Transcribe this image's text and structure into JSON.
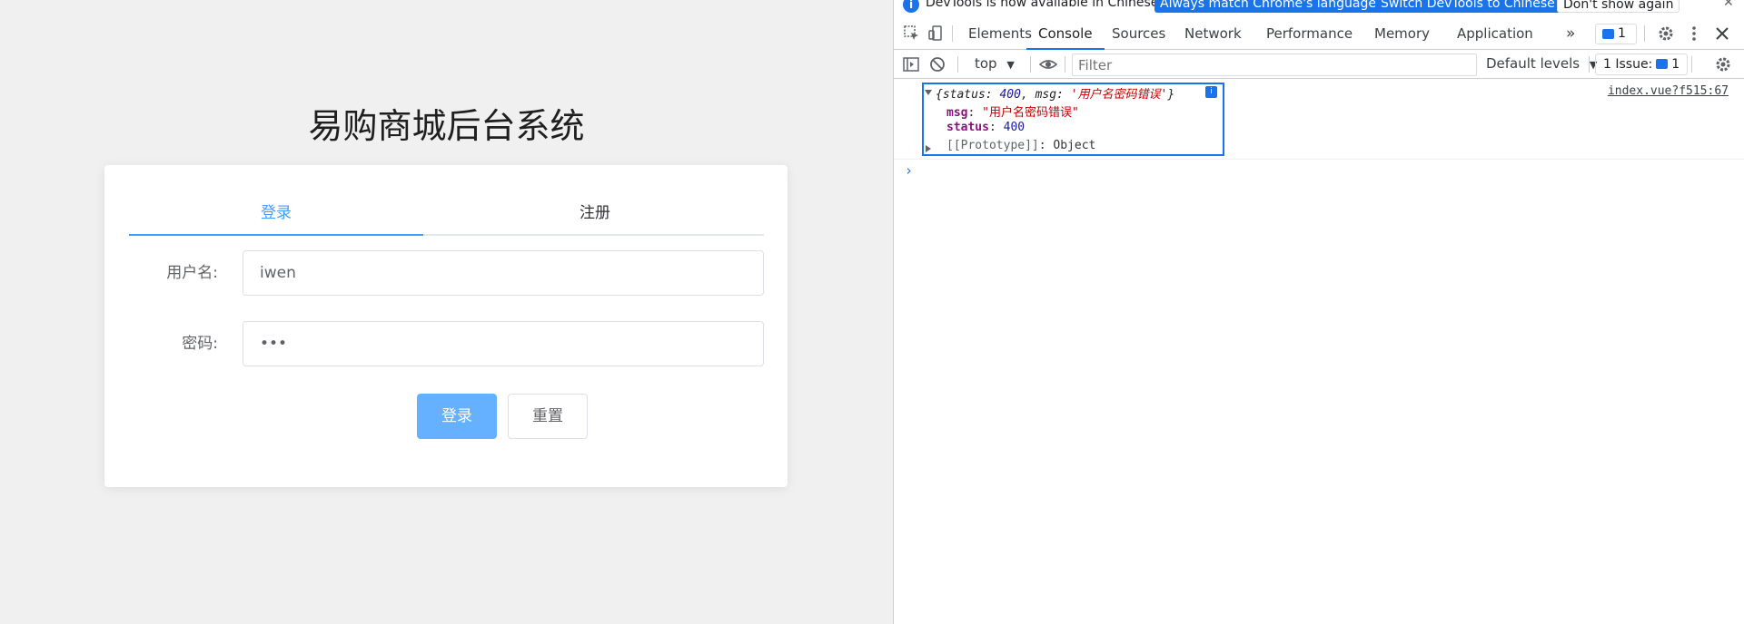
{
  "app": {
    "title": "易购商城后台系统",
    "tabs": [
      {
        "label": "登录",
        "active": true
      },
      {
        "label": "注册",
        "active": false
      }
    ],
    "form": {
      "username_label": "用户名:",
      "username_value": "iwen",
      "password_label": "密码:",
      "password_value": "•••"
    },
    "buttons": {
      "login": "登录",
      "reset": "重置"
    },
    "accent_color": "#409eff"
  },
  "devtools": {
    "infobar": {
      "text": "DevTools is now available in Chinese!",
      "btn_match": "Always match Chrome's language",
      "btn_switch": "Switch DevTools to Chinese",
      "btn_dismiss": "Don't show again"
    },
    "tabs": [
      "Elements",
      "Console",
      "Sources",
      "Network",
      "Performance",
      "Memory",
      "Application"
    ],
    "active_tab": "Console",
    "message_count": "1",
    "console_toolbar": {
      "context": "top",
      "filter_placeholder": "Filter",
      "levels": "Default levels",
      "issues_label": "1 Issue:",
      "issues_count": "1"
    },
    "log": {
      "summary_open": "{status: ",
      "summary_status": "400",
      "summary_mid": ", msg: ",
      "summary_msg": "'用户名密码错误'",
      "summary_close": "}",
      "msg_key": "msg",
      "msg_value": "\"用户名密码错误\"",
      "status_key": "status",
      "status_value": "400",
      "proto_key": "[[Prototype]]",
      "proto_value": "Object",
      "source": "index.vue?f515:67"
    }
  }
}
